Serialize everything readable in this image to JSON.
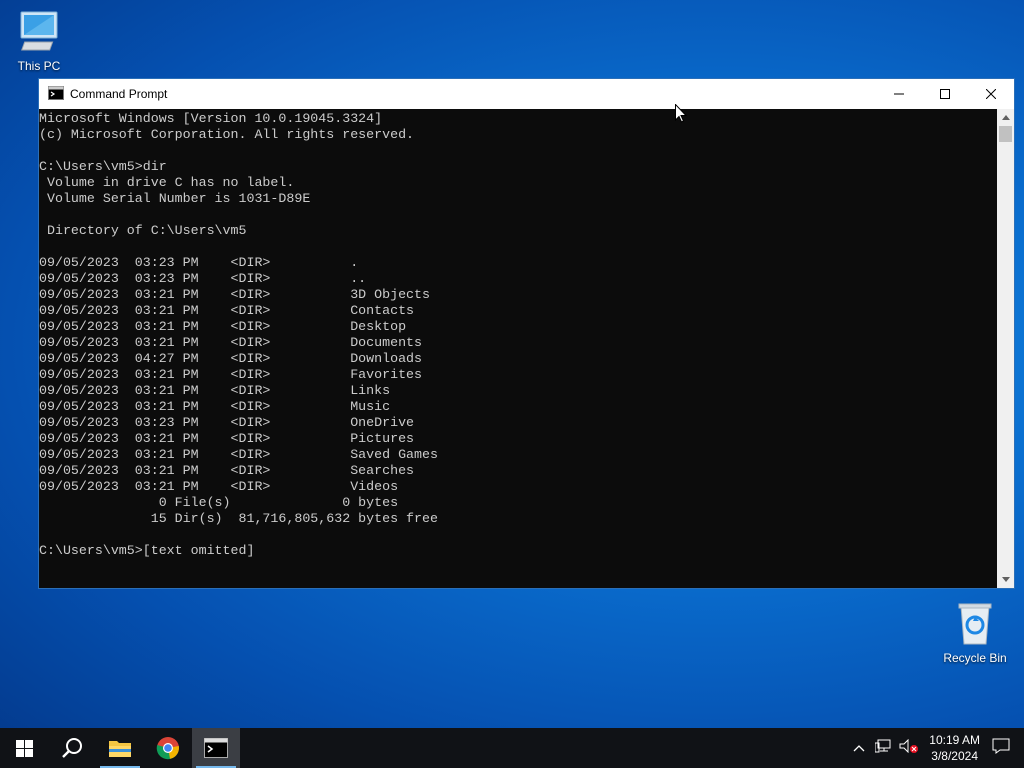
{
  "desktop": {
    "icons": [
      {
        "label": "This PC"
      },
      {
        "label": "Recycle Bin"
      }
    ]
  },
  "window": {
    "title": "Command Prompt",
    "console_lines": [
      "Microsoft Windows [Version 10.0.19045.3324]",
      "(c) Microsoft Corporation. All rights reserved.",
      "",
      "C:\\Users\\vm5>dir",
      " Volume in drive C has no label.",
      " Volume Serial Number is 1031-D89E",
      "",
      " Directory of C:\\Users\\vm5",
      "",
      "09/05/2023  03:23 PM    <DIR>          .",
      "09/05/2023  03:23 PM    <DIR>          ..",
      "09/05/2023  03:21 PM    <DIR>          3D Objects",
      "09/05/2023  03:21 PM    <DIR>          Contacts",
      "09/05/2023  03:21 PM    <DIR>          Desktop",
      "09/05/2023  03:21 PM    <DIR>          Documents",
      "09/05/2023  04:27 PM    <DIR>          Downloads",
      "09/05/2023  03:21 PM    <DIR>          Favorites",
      "09/05/2023  03:21 PM    <DIR>          Links",
      "09/05/2023  03:21 PM    <DIR>          Music",
      "09/05/2023  03:23 PM    <DIR>          OneDrive",
      "09/05/2023  03:21 PM    <DIR>          Pictures",
      "09/05/2023  03:21 PM    <DIR>          Saved Games",
      "09/05/2023  03:21 PM    <DIR>          Searches",
      "09/05/2023  03:21 PM    <DIR>          Videos",
      "               0 File(s)              0 bytes",
      "              15 Dir(s)  81,716,805,632 bytes free",
      "",
      "C:\\Users\\vm5>[text omitted]"
    ]
  },
  "taskbar": {
    "apps": [
      {
        "name": "Search"
      },
      {
        "name": "File Explorer"
      },
      {
        "name": "Google Chrome"
      },
      {
        "name": "Command Prompt"
      }
    ],
    "clock": {
      "time": "10:19 AM",
      "date": "3/8/2024"
    }
  }
}
